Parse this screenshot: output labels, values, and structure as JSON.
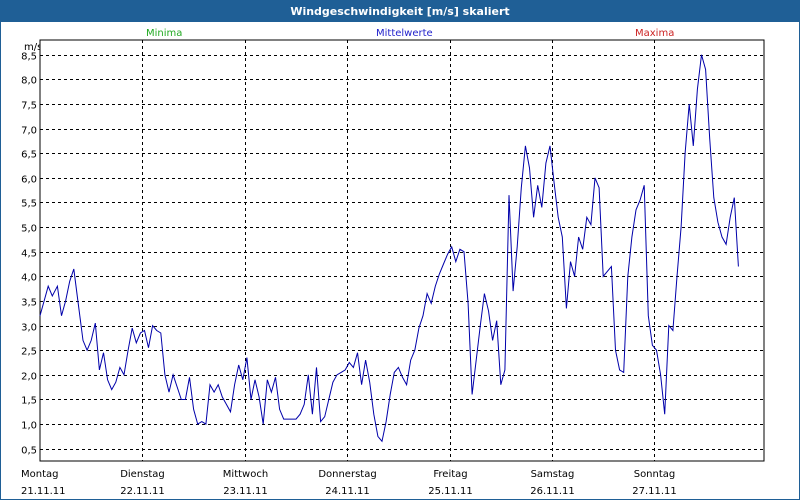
{
  "window_title": "Windgeschwindigkeit [m/s] skaliert",
  "legend": [
    {
      "label": "Minima",
      "color": "#22aa22"
    },
    {
      "label": "Mittelwerte",
      "color": "#2222cc"
    },
    {
      "label": "Maxima",
      "color": "#cc2222"
    }
  ],
  "chart_data": {
    "type": "line",
    "title": "Windgeschwindigkeit [m/s] skaliert",
    "ylabel": "m/s",
    "ylim": [
      0.25,
      8.8
    ],
    "yticks": [
      "0,5",
      "1,0",
      "1,5",
      "2,0",
      "2,5",
      "3,0",
      "3,5",
      "4,0",
      "4,5",
      "5,0",
      "5,5",
      "6,0",
      "6,5",
      "7,0",
      "7,5",
      "8,0",
      "8,5"
    ],
    "ytick_values": [
      0.5,
      1.0,
      1.5,
      2.0,
      2.5,
      3.0,
      3.5,
      4.0,
      4.5,
      5.0,
      5.5,
      6.0,
      6.5,
      7.0,
      7.5,
      8.0,
      8.5
    ],
    "xlim": [
      0,
      7.07
    ],
    "x_ticks": [
      {
        "day": "Montag",
        "date": "21.11.11",
        "x": 0
      },
      {
        "day": "Dienstag",
        "date": "22.11.11",
        "x": 1
      },
      {
        "day": "Mittwoch",
        "date": "23.11.11",
        "x": 2
      },
      {
        "day": "Donnerstag",
        "date": "24.11.11",
        "x": 3
      },
      {
        "day": "Freitag",
        "date": "25.11.11",
        "x": 4
      },
      {
        "day": "Samstag",
        "date": "26.11.11",
        "x": 5
      },
      {
        "day": "Sonntag",
        "date": "27.11.11",
        "x": 6
      }
    ],
    "grid": true,
    "series": [
      {
        "name": "Mittelwerte",
        "color": "#0000aa",
        "points": [
          [
            0.0,
            3.2
          ],
          [
            0.04,
            3.5
          ],
          [
            0.08,
            3.8
          ],
          [
            0.12,
            3.6
          ],
          [
            0.17,
            3.8
          ],
          [
            0.21,
            3.2
          ],
          [
            0.25,
            3.5
          ],
          [
            0.29,
            3.9
          ],
          [
            0.33,
            4.15
          ],
          [
            0.37,
            3.5
          ],
          [
            0.42,
            2.7
          ],
          [
            0.46,
            2.5
          ],
          [
            0.5,
            2.7
          ],
          [
            0.54,
            3.05
          ],
          [
            0.58,
            2.1
          ],
          [
            0.62,
            2.45
          ],
          [
            0.66,
            1.9
          ],
          [
            0.7,
            1.7
          ],
          [
            0.74,
            1.85
          ],
          [
            0.78,
            2.15
          ],
          [
            0.82,
            2.0
          ],
          [
            0.86,
            2.5
          ],
          [
            0.9,
            2.95
          ],
          [
            0.94,
            2.65
          ],
          [
            0.98,
            2.85
          ],
          [
            1.02,
            2.9
          ],
          [
            1.06,
            2.55
          ],
          [
            1.1,
            3.0
          ],
          [
            1.14,
            2.9
          ],
          [
            1.18,
            2.85
          ],
          [
            1.22,
            2.0
          ],
          [
            1.26,
            1.65
          ],
          [
            1.3,
            2.0
          ],
          [
            1.34,
            1.75
          ],
          [
            1.38,
            1.5
          ],
          [
            1.42,
            1.5
          ],
          [
            1.46,
            1.95
          ],
          [
            1.5,
            1.3
          ],
          [
            1.54,
            1.0
          ],
          [
            1.58,
            1.05
          ],
          [
            1.62,
            1.0
          ],
          [
            1.66,
            1.8
          ],
          [
            1.7,
            1.65
          ],
          [
            1.74,
            1.8
          ],
          [
            1.78,
            1.55
          ],
          [
            1.82,
            1.4
          ],
          [
            1.86,
            1.25
          ],
          [
            1.9,
            1.8
          ],
          [
            1.94,
            2.2
          ],
          [
            1.98,
            1.9
          ],
          [
            2.02,
            2.35
          ],
          [
            2.06,
            1.5
          ],
          [
            2.1,
            1.9
          ],
          [
            2.14,
            1.55
          ],
          [
            2.18,
            1.0
          ],
          [
            2.22,
            1.9
          ],
          [
            2.26,
            1.65
          ],
          [
            2.3,
            1.95
          ],
          [
            2.34,
            1.3
          ],
          [
            2.38,
            1.1
          ],
          [
            2.42,
            1.1
          ],
          [
            2.46,
            1.1
          ],
          [
            2.5,
            1.1
          ],
          [
            2.54,
            1.2
          ],
          [
            2.58,
            1.4
          ],
          [
            2.62,
            2.0
          ],
          [
            2.66,
            1.2
          ],
          [
            2.7,
            2.15
          ],
          [
            2.74,
            1.05
          ],
          [
            2.78,
            1.15
          ],
          [
            2.82,
            1.5
          ],
          [
            2.86,
            1.85
          ],
          [
            2.9,
            2.0
          ],
          [
            2.94,
            2.05
          ],
          [
            2.98,
            2.1
          ],
          [
            3.02,
            2.25
          ],
          [
            3.06,
            2.15
          ],
          [
            3.1,
            2.45
          ],
          [
            3.14,
            1.8
          ],
          [
            3.18,
            2.3
          ],
          [
            3.22,
            1.85
          ],
          [
            3.26,
            1.2
          ],
          [
            3.3,
            0.75
          ],
          [
            3.34,
            0.65
          ],
          [
            3.38,
            1.05
          ],
          [
            3.42,
            1.6
          ],
          [
            3.46,
            2.05
          ],
          [
            3.5,
            2.15
          ],
          [
            3.54,
            1.95
          ],
          [
            3.58,
            1.8
          ],
          [
            3.62,
            2.3
          ],
          [
            3.66,
            2.5
          ],
          [
            3.7,
            2.95
          ],
          [
            3.74,
            3.2
          ],
          [
            3.78,
            3.65
          ],
          [
            3.82,
            3.45
          ],
          [
            3.86,
            3.8
          ],
          [
            3.9,
            4.05
          ],
          [
            3.94,
            4.25
          ],
          [
            3.98,
            4.45
          ],
          [
            4.02,
            4.6
          ],
          [
            4.06,
            4.3
          ],
          [
            4.1,
            4.55
          ],
          [
            4.14,
            4.5
          ],
          [
            4.18,
            3.45
          ],
          [
            4.22,
            1.6
          ],
          [
            4.26,
            2.3
          ],
          [
            4.3,
            3.0
          ],
          [
            4.34,
            3.65
          ],
          [
            4.38,
            3.3
          ],
          [
            4.42,
            2.7
          ],
          [
            4.46,
            3.1
          ],
          [
            4.5,
            1.8
          ],
          [
            4.54,
            2.1
          ],
          [
            4.58,
            5.65
          ],
          [
            4.62,
            3.7
          ],
          [
            4.66,
            4.6
          ],
          [
            4.7,
            5.8
          ],
          [
            4.74,
            6.65
          ],
          [
            4.78,
            6.2
          ],
          [
            4.82,
            5.2
          ],
          [
            4.86,
            5.85
          ],
          [
            4.9,
            5.4
          ],
          [
            4.94,
            6.3
          ],
          [
            4.98,
            6.65
          ],
          [
            5.02,
            5.9
          ],
          [
            5.06,
            5.2
          ],
          [
            5.1,
            4.8
          ],
          [
            5.14,
            3.35
          ],
          [
            5.18,
            4.3
          ],
          [
            5.22,
            4.0
          ],
          [
            5.26,
            4.8
          ],
          [
            5.3,
            4.55
          ],
          [
            5.34,
            5.2
          ],
          [
            5.38,
            5.05
          ],
          [
            5.42,
            6.0
          ],
          [
            5.46,
            5.8
          ],
          [
            5.5,
            4.0
          ],
          [
            5.54,
            4.1
          ],
          [
            5.58,
            4.2
          ],
          [
            5.62,
            2.5
          ],
          [
            5.66,
            2.1
          ],
          [
            5.7,
            2.05
          ],
          [
            5.74,
            4.0
          ],
          [
            5.78,
            4.8
          ],
          [
            5.82,
            5.35
          ],
          [
            5.86,
            5.55
          ],
          [
            5.9,
            5.85
          ],
          [
            5.94,
            3.2
          ],
          [
            5.98,
            2.6
          ],
          [
            6.02,
            2.5
          ],
          [
            6.06,
            2.0
          ],
          [
            6.1,
            1.2
          ],
          [
            6.14,
            3.0
          ],
          [
            6.18,
            2.9
          ],
          [
            6.22,
            4.0
          ],
          [
            6.26,
            5.0
          ],
          [
            6.3,
            6.5
          ],
          [
            6.34,
            7.5
          ],
          [
            6.38,
            6.65
          ],
          [
            6.42,
            7.8
          ],
          [
            6.46,
            8.5
          ],
          [
            6.5,
            8.2
          ],
          [
            6.54,
            6.8
          ],
          [
            6.58,
            5.6
          ],
          [
            6.62,
            5.1
          ],
          [
            6.66,
            4.8
          ],
          [
            6.7,
            4.65
          ],
          [
            6.74,
            5.2
          ],
          [
            6.78,
            5.6
          ],
          [
            6.82,
            4.2
          ]
        ]
      }
    ]
  }
}
